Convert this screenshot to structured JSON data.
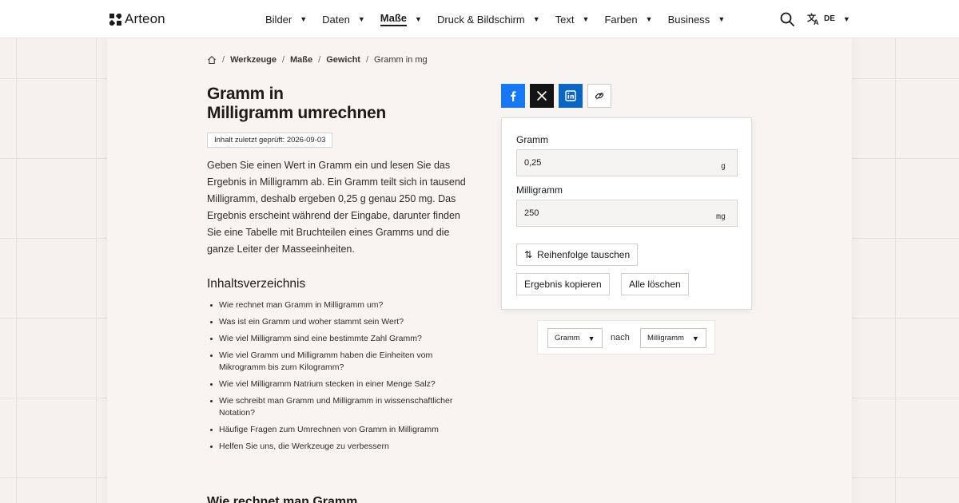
{
  "header": {
    "brand": "Arteon",
    "nav": [
      {
        "label": "Bilder",
        "active": false
      },
      {
        "label": "Daten",
        "active": false
      },
      {
        "label": "Maße",
        "active": true
      },
      {
        "label": "Druck & Bildschirm",
        "active": false
      },
      {
        "label": "Text",
        "active": false
      },
      {
        "label": "Farben",
        "active": false
      },
      {
        "label": "Business",
        "active": false
      }
    ],
    "language": "DE",
    "caret": "▼"
  },
  "breadcrumb": {
    "sep": "/",
    "items": [
      "Werkzeuge",
      "Maße",
      "Gewicht"
    ],
    "current": "Gramm in mg"
  },
  "page": {
    "title_line1": "Gramm in",
    "title_line2": "Milligramm umrechnen",
    "badge": "Inhalt zuletzt geprüft: 2026-09-03",
    "intro": "Geben Sie einen Wert in Gramm ein und lesen Sie das Ergebnis in Milligramm ab. Ein Gramm teilt sich in tausend Milligramm, deshalb ergeben 0,25 g genau 250 mg. Das Ergebnis erscheint während der Eingabe, darunter finden Sie eine Tabelle mit Bruchteilen eines Gramms und die ganze Leiter der Masseeinheiten.",
    "toc_heading": "Inhaltsverzeichnis",
    "toc": [
      "Wie rechnet man Gramm in Milligramm um?",
      "Was ist ein Gramm und woher stammt sein Wert?",
      "Wie viel Milligramm sind eine bestimmte Zahl Gramm?",
      "Wie viel Gramm und Milligramm haben die Einheiten vom Mikrogramm bis zum Kilogramm?",
      "Wie viel Milligramm Natrium stecken in einer Menge Salz?",
      "Wie schreibt man Gramm und Milligramm in wissenschaftlicher Notation?",
      "Häufige Fragen zum Umrechnen von Gramm in Milligramm",
      "Helfen Sie uns, die Werkzeuge zu verbessern"
    ],
    "next_section_peek": "Wie rechnet man Gramm"
  },
  "converter": {
    "from_label": "Gramm",
    "from_value": "0,25",
    "from_unit": "g",
    "to_label": "Milligramm",
    "to_value": "250",
    "to_unit": "mg",
    "swap_label": "Reihenfolge tauschen",
    "copy_label": "Ergebnis kopieren",
    "clear_label": "Alle löschen"
  },
  "unit_select": {
    "from": "Gramm",
    "connector": "nach",
    "to": "Milligramm"
  },
  "colors": {
    "facebook": "#1877f2",
    "x": "#141414",
    "linkedin": "#0a66c2"
  }
}
